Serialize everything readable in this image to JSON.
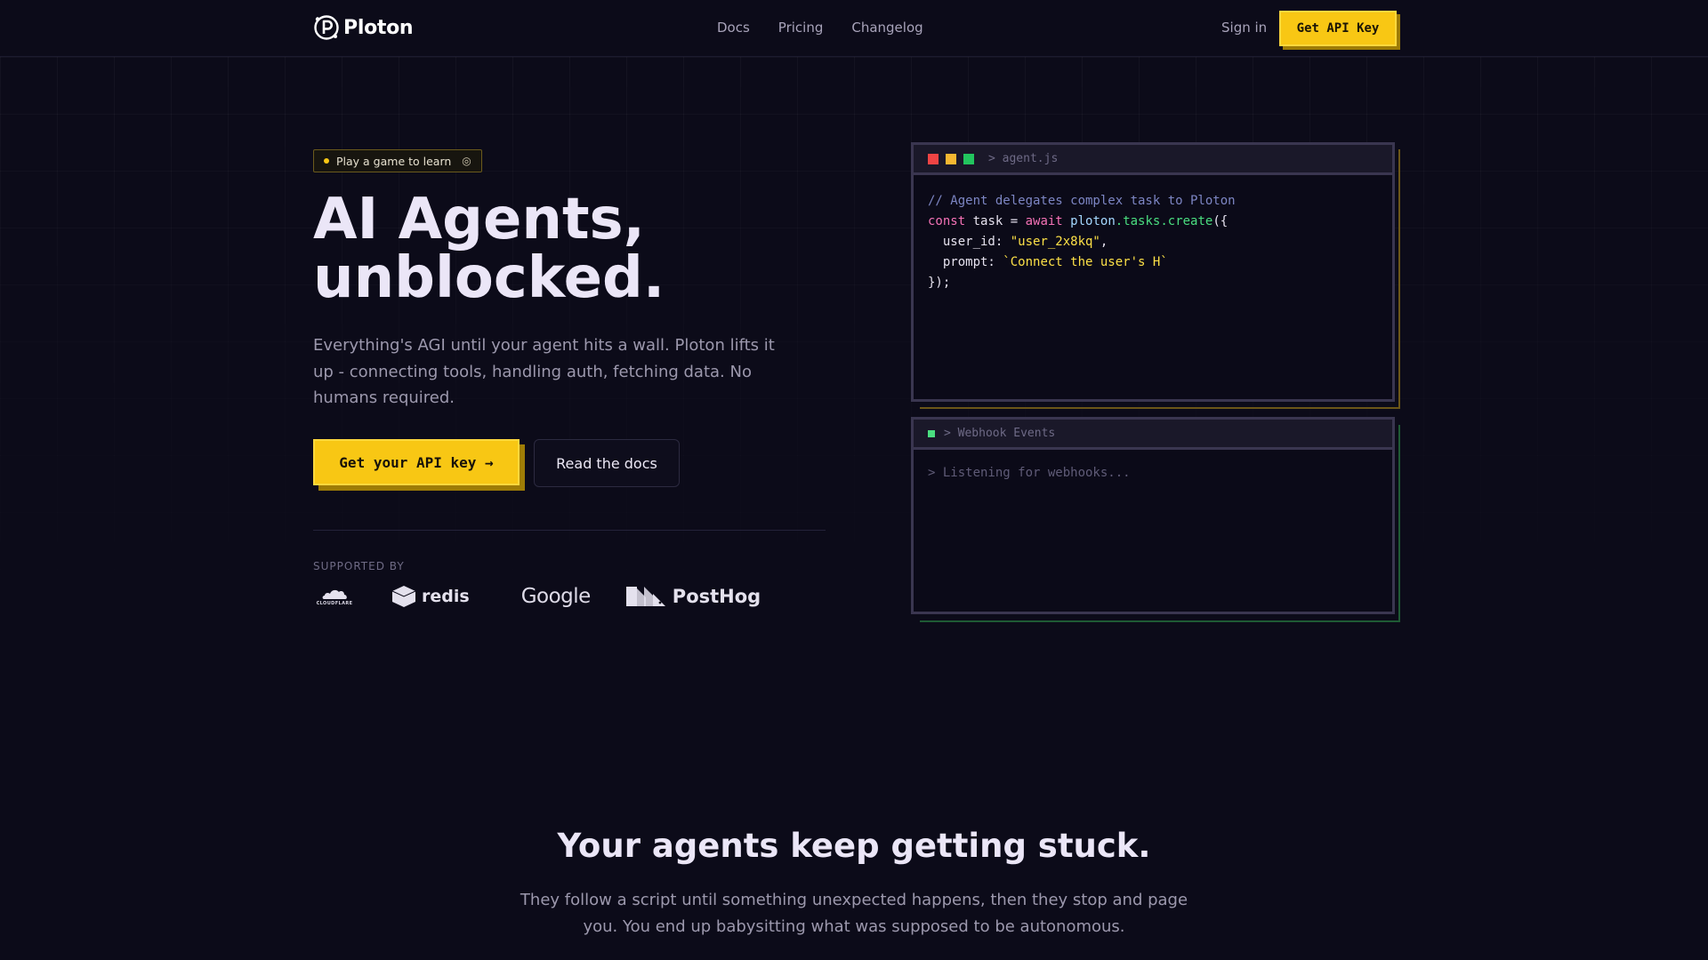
{
  "nav": {
    "brand": "Ploton",
    "links": [
      "Docs",
      "Pricing",
      "Changelog"
    ],
    "signin": "Sign in",
    "cta": "Get API Key"
  },
  "hero": {
    "badge": "Play a game to learn",
    "title_line1": "AI Agents,",
    "title_line2": "unblocked.",
    "subtitle": "Everything's AGI until your agent hits a wall. Ploton lifts it up - connecting tools, handling auth, fetching data. No humans required.",
    "primary_button": "Get your API key →",
    "secondary_button": "Read the docs",
    "supported_label": "SUPPORTED BY",
    "sponsors": {
      "cloudflare": "CLOUDFLARE",
      "redis": "redis",
      "google": "Google",
      "posthog": "PostHog"
    }
  },
  "code_panel": {
    "filename": "> agent.js",
    "lines": {
      "comment": "// Agent delegates complex task to Ploton",
      "l2_kw1": "const",
      "l2_var": " task = ",
      "l2_kw2": "await",
      "l2_obj": " ploton",
      "l2_fn": ".tasks.create",
      "l2_end": "({",
      "l3_key": "  user_id: ",
      "l3_val": "\"user_2x8kq\"",
      "l3_end": ",",
      "l4_key": "  prompt: ",
      "l4_val": "`Connect the user's H`",
      "l5": "});"
    }
  },
  "webhook_panel": {
    "title": "> Webhook Events",
    "status": "> Listening for webhooks..."
  },
  "section2": {
    "title": "Your agents keep getting stuck.",
    "subtitle": "They follow a script until something unexpected happens, then they stop and page you. You end up babysitting what was supposed to be autonomous."
  },
  "colors": {
    "background": "#0c0b19",
    "accent": "#f8c714",
    "traffic_red": "#ef4444",
    "traffic_yellow": "#f5b731",
    "traffic_green": "#22c55e",
    "webhook_green": "#4ade80"
  }
}
